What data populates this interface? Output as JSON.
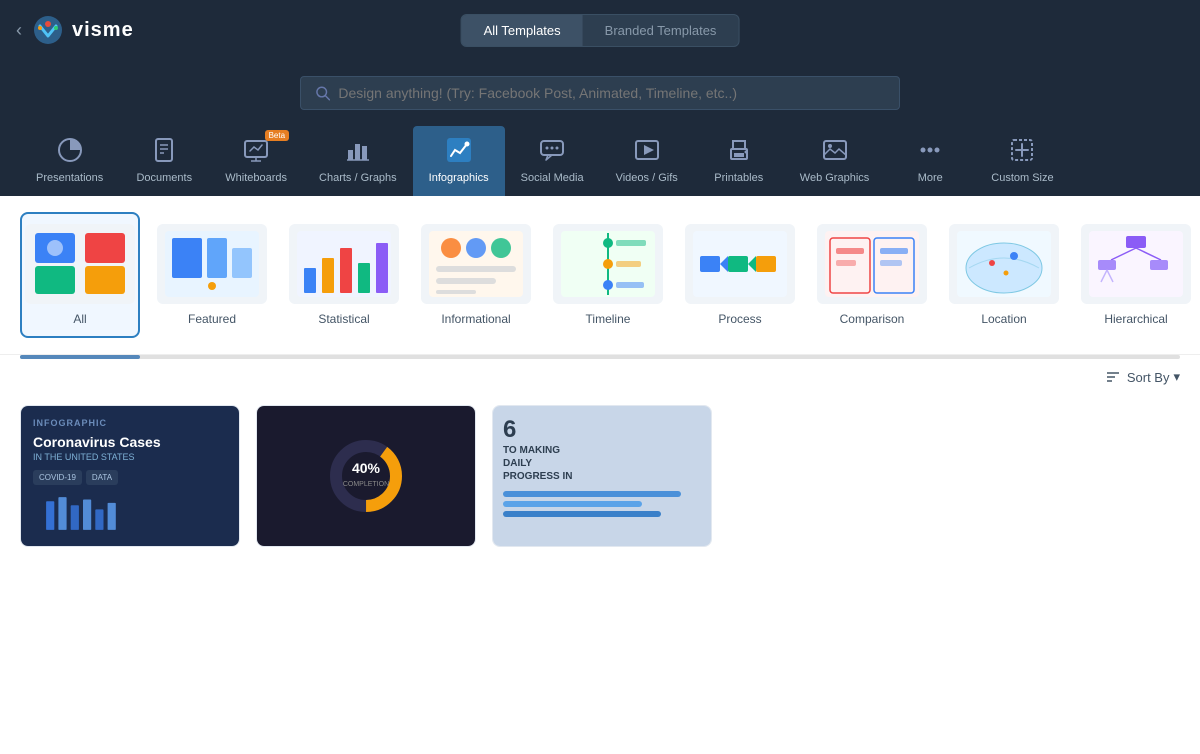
{
  "logo": {
    "text": "visme"
  },
  "nav": {
    "back_label": "‹",
    "all_templates_label": "All Templates",
    "branded_templates_label": "Branded Templates"
  },
  "search": {
    "placeholder": "Design anything! (Try: Facebook Post, Animated, Timeline, etc..)"
  },
  "categories": [
    {
      "id": "presentations",
      "label": "Presentations",
      "icon": "pie-chart"
    },
    {
      "id": "documents",
      "label": "Documents",
      "icon": "document"
    },
    {
      "id": "whiteboards",
      "label": "Whiteboards",
      "icon": "whiteboard",
      "beta": true
    },
    {
      "id": "charts",
      "label": "Charts / Graphs",
      "icon": "bar-chart"
    },
    {
      "id": "infographics",
      "label": "Infographics",
      "icon": "trend-chart",
      "active": true
    },
    {
      "id": "social",
      "label": "Social Media",
      "icon": "speech-bubble"
    },
    {
      "id": "videos",
      "label": "Videos / Gifs",
      "icon": "video-play"
    },
    {
      "id": "printables",
      "label": "Printables",
      "icon": "printer"
    },
    {
      "id": "web-graphics",
      "label": "Web Graphics",
      "icon": "image"
    },
    {
      "id": "more",
      "label": "More",
      "icon": "more-dots"
    },
    {
      "id": "custom-size",
      "label": "Custom Size",
      "icon": "custom-size"
    }
  ],
  "subcategories": [
    {
      "id": "all",
      "label": "All",
      "active": true
    },
    {
      "id": "featured",
      "label": "Featured"
    },
    {
      "id": "statistical",
      "label": "Statistical"
    },
    {
      "id": "informational",
      "label": "Informational"
    },
    {
      "id": "timeline",
      "label": "Timeline"
    },
    {
      "id": "process",
      "label": "Process"
    },
    {
      "id": "comparison",
      "label": "Comparison"
    },
    {
      "id": "location",
      "label": "Location"
    },
    {
      "id": "hierarchical",
      "label": "Hierarchical"
    }
  ],
  "sort": {
    "label": "Sort By",
    "arrow": "▾"
  },
  "template_cards": [
    {
      "id": "card1",
      "bg": "#1b2c4e",
      "title": "Coronavirus Cases",
      "subtitle": "IN THE UNITED STATES"
    },
    {
      "id": "card2",
      "bg": "#2d2d2d",
      "title": "40%",
      "subtitle": ""
    },
    {
      "id": "card3",
      "bg": "#d0d8e8",
      "title": "6",
      "subtitle": "TO MAKING DAILY PROGRESS IN"
    }
  ]
}
